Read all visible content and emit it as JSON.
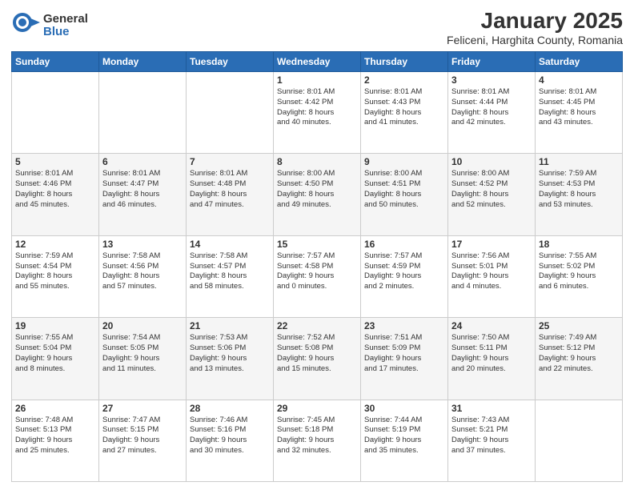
{
  "logo": {
    "general": "General",
    "blue": "Blue"
  },
  "title": "January 2025",
  "subtitle": "Feliceni, Harghita County, Romania",
  "days_of_week": [
    "Sunday",
    "Monday",
    "Tuesday",
    "Wednesday",
    "Thursday",
    "Friday",
    "Saturday"
  ],
  "weeks": [
    [
      {
        "day": "",
        "info": ""
      },
      {
        "day": "",
        "info": ""
      },
      {
        "day": "",
        "info": ""
      },
      {
        "day": "1",
        "info": "Sunrise: 8:01 AM\nSunset: 4:42 PM\nDaylight: 8 hours\nand 40 minutes."
      },
      {
        "day": "2",
        "info": "Sunrise: 8:01 AM\nSunset: 4:43 PM\nDaylight: 8 hours\nand 41 minutes."
      },
      {
        "day": "3",
        "info": "Sunrise: 8:01 AM\nSunset: 4:44 PM\nDaylight: 8 hours\nand 42 minutes."
      },
      {
        "day": "4",
        "info": "Sunrise: 8:01 AM\nSunset: 4:45 PM\nDaylight: 8 hours\nand 43 minutes."
      }
    ],
    [
      {
        "day": "5",
        "info": "Sunrise: 8:01 AM\nSunset: 4:46 PM\nDaylight: 8 hours\nand 45 minutes."
      },
      {
        "day": "6",
        "info": "Sunrise: 8:01 AM\nSunset: 4:47 PM\nDaylight: 8 hours\nand 46 minutes."
      },
      {
        "day": "7",
        "info": "Sunrise: 8:01 AM\nSunset: 4:48 PM\nDaylight: 8 hours\nand 47 minutes."
      },
      {
        "day": "8",
        "info": "Sunrise: 8:00 AM\nSunset: 4:50 PM\nDaylight: 8 hours\nand 49 minutes."
      },
      {
        "day": "9",
        "info": "Sunrise: 8:00 AM\nSunset: 4:51 PM\nDaylight: 8 hours\nand 50 minutes."
      },
      {
        "day": "10",
        "info": "Sunrise: 8:00 AM\nSunset: 4:52 PM\nDaylight: 8 hours\nand 52 minutes."
      },
      {
        "day": "11",
        "info": "Sunrise: 7:59 AM\nSunset: 4:53 PM\nDaylight: 8 hours\nand 53 minutes."
      }
    ],
    [
      {
        "day": "12",
        "info": "Sunrise: 7:59 AM\nSunset: 4:54 PM\nDaylight: 8 hours\nand 55 minutes."
      },
      {
        "day": "13",
        "info": "Sunrise: 7:58 AM\nSunset: 4:56 PM\nDaylight: 8 hours\nand 57 minutes."
      },
      {
        "day": "14",
        "info": "Sunrise: 7:58 AM\nSunset: 4:57 PM\nDaylight: 8 hours\nand 58 minutes."
      },
      {
        "day": "15",
        "info": "Sunrise: 7:57 AM\nSunset: 4:58 PM\nDaylight: 9 hours\nand 0 minutes."
      },
      {
        "day": "16",
        "info": "Sunrise: 7:57 AM\nSunset: 4:59 PM\nDaylight: 9 hours\nand 2 minutes."
      },
      {
        "day": "17",
        "info": "Sunrise: 7:56 AM\nSunset: 5:01 PM\nDaylight: 9 hours\nand 4 minutes."
      },
      {
        "day": "18",
        "info": "Sunrise: 7:55 AM\nSunset: 5:02 PM\nDaylight: 9 hours\nand 6 minutes."
      }
    ],
    [
      {
        "day": "19",
        "info": "Sunrise: 7:55 AM\nSunset: 5:04 PM\nDaylight: 9 hours\nand 8 minutes."
      },
      {
        "day": "20",
        "info": "Sunrise: 7:54 AM\nSunset: 5:05 PM\nDaylight: 9 hours\nand 11 minutes."
      },
      {
        "day": "21",
        "info": "Sunrise: 7:53 AM\nSunset: 5:06 PM\nDaylight: 9 hours\nand 13 minutes."
      },
      {
        "day": "22",
        "info": "Sunrise: 7:52 AM\nSunset: 5:08 PM\nDaylight: 9 hours\nand 15 minutes."
      },
      {
        "day": "23",
        "info": "Sunrise: 7:51 AM\nSunset: 5:09 PM\nDaylight: 9 hours\nand 17 minutes."
      },
      {
        "day": "24",
        "info": "Sunrise: 7:50 AM\nSunset: 5:11 PM\nDaylight: 9 hours\nand 20 minutes."
      },
      {
        "day": "25",
        "info": "Sunrise: 7:49 AM\nSunset: 5:12 PM\nDaylight: 9 hours\nand 22 minutes."
      }
    ],
    [
      {
        "day": "26",
        "info": "Sunrise: 7:48 AM\nSunset: 5:13 PM\nDaylight: 9 hours\nand 25 minutes."
      },
      {
        "day": "27",
        "info": "Sunrise: 7:47 AM\nSunset: 5:15 PM\nDaylight: 9 hours\nand 27 minutes."
      },
      {
        "day": "28",
        "info": "Sunrise: 7:46 AM\nSunset: 5:16 PM\nDaylight: 9 hours\nand 30 minutes."
      },
      {
        "day": "29",
        "info": "Sunrise: 7:45 AM\nSunset: 5:18 PM\nDaylight: 9 hours\nand 32 minutes."
      },
      {
        "day": "30",
        "info": "Sunrise: 7:44 AM\nSunset: 5:19 PM\nDaylight: 9 hours\nand 35 minutes."
      },
      {
        "day": "31",
        "info": "Sunrise: 7:43 AM\nSunset: 5:21 PM\nDaylight: 9 hours\nand 37 minutes."
      },
      {
        "day": "",
        "info": ""
      }
    ]
  ]
}
